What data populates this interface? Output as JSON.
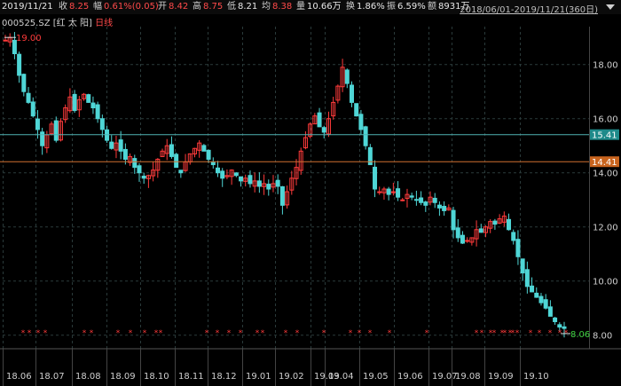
{
  "header": {
    "date": "2019/11/21",
    "close_label": "收",
    "close": "8.25",
    "change_label": "幅",
    "change": "0.61%(0.05)",
    "open_label": "开",
    "open": "8.42",
    "high_label": "高",
    "high": "8.75",
    "low_label": "低",
    "low": "8.21",
    "avg_label": "均",
    "avg": "8.38",
    "volume_label": "量",
    "volume": "10.66万",
    "turnover_label": "换",
    "turnover": "1.86%",
    "amplitude_label": "振",
    "amplitude": "6.59%",
    "amount_label": "额",
    "amount": "8931万",
    "date_range": "2018/06/01-2019/11/21(360日)"
  },
  "sub": {
    "code": "000525.SZ",
    "name": "[红 太 阳]",
    "period": "日线"
  },
  "colors": {
    "up": "#ff3b3b",
    "down": "#4fd6d6",
    "grid": "#2a3a3a",
    "line_teal": "#4fb3b3",
    "line_orange": "#d07030",
    "badge_teal": "#1e8a8a",
    "badge_orange": "#c8641e",
    "low_label": "#40d040"
  },
  "chart_data": {
    "type": "candlestick",
    "y_ticks": [
      8,
      10,
      12,
      14,
      16,
      18
    ],
    "y_tick_labels": [
      "8.00",
      "10.00",
      "12.00",
      "14.00",
      "16.00",
      "18.00"
    ],
    "y_range": [
      7.5,
      19.4
    ],
    "x_labels": [
      "18.06",
      "18.07",
      "18.08",
      "18.09",
      "18.10",
      "18.11",
      "18.12",
      "19.01",
      "19.02",
      "19.03",
      "19.04",
      "19.05",
      "19.06",
      "19.07",
      "19.08",
      "19.09",
      "19.10"
    ],
    "h_lines": [
      {
        "value": 15.41,
        "label": "15.41",
        "color": "teal"
      },
      {
        "value": 14.41,
        "label": "14.41",
        "color": "orange"
      }
    ],
    "annotations": [
      {
        "text": "19.00",
        "value": 19.0,
        "position": "left"
      },
      {
        "text": "8.06",
        "value": 8.06,
        "position": "right"
      }
    ],
    "price_path": [
      18.9,
      19.0,
      18.4,
      17.6,
      17.0,
      16.6,
      16.1,
      15.6,
      15.0,
      15.4,
      15.8,
      15.2,
      15.9,
      16.4,
      16.8,
      16.3,
      16.7,
      16.9,
      16.6,
      16.4,
      16.0,
      15.6,
      15.2,
      14.9,
      15.1,
      14.8,
      14.5,
      14.6,
      14.2,
      14.0,
      13.8,
      13.9,
      14.1,
      14.5,
      14.8,
      15.0,
      14.6,
      14.2,
      14.0,
      14.4,
      14.7,
      14.9,
      15.1,
      14.8,
      14.5,
      14.3,
      14.0,
      13.8,
      13.9,
      14.1,
      13.9,
      13.7,
      13.8,
      13.6,
      13.7,
      13.5,
      13.6,
      13.4,
      13.6,
      13.5,
      12.8,
      13.3,
      13.8,
      14.2,
      14.8,
      15.3,
      15.8,
      16.1,
      15.7,
      15.5,
      16.0,
      16.6,
      17.2,
      17.9,
      17.3,
      16.6,
      16.1,
      15.6,
      15.0,
      14.3,
      13.4,
      13.3,
      13.4,
      13.2,
      13.3,
      13.1,
      13.0,
      13.2,
      13.1,
      13.0,
      12.9,
      12.8,
      13.1,
      12.9,
      12.7,
      12.6,
      12.7,
      11.9,
      11.6,
      11.4,
      11.5,
      11.6,
      11.9,
      11.8,
      12.0,
      12.2,
      12.1,
      12.3,
      12.4,
      11.9,
      11.5,
      10.9,
      10.3,
      9.8,
      9.6,
      9.4,
      9.2,
      9.0,
      8.7,
      8.5,
      8.3,
      8.25
    ],
    "markers": "stars along bottom, red"
  }
}
